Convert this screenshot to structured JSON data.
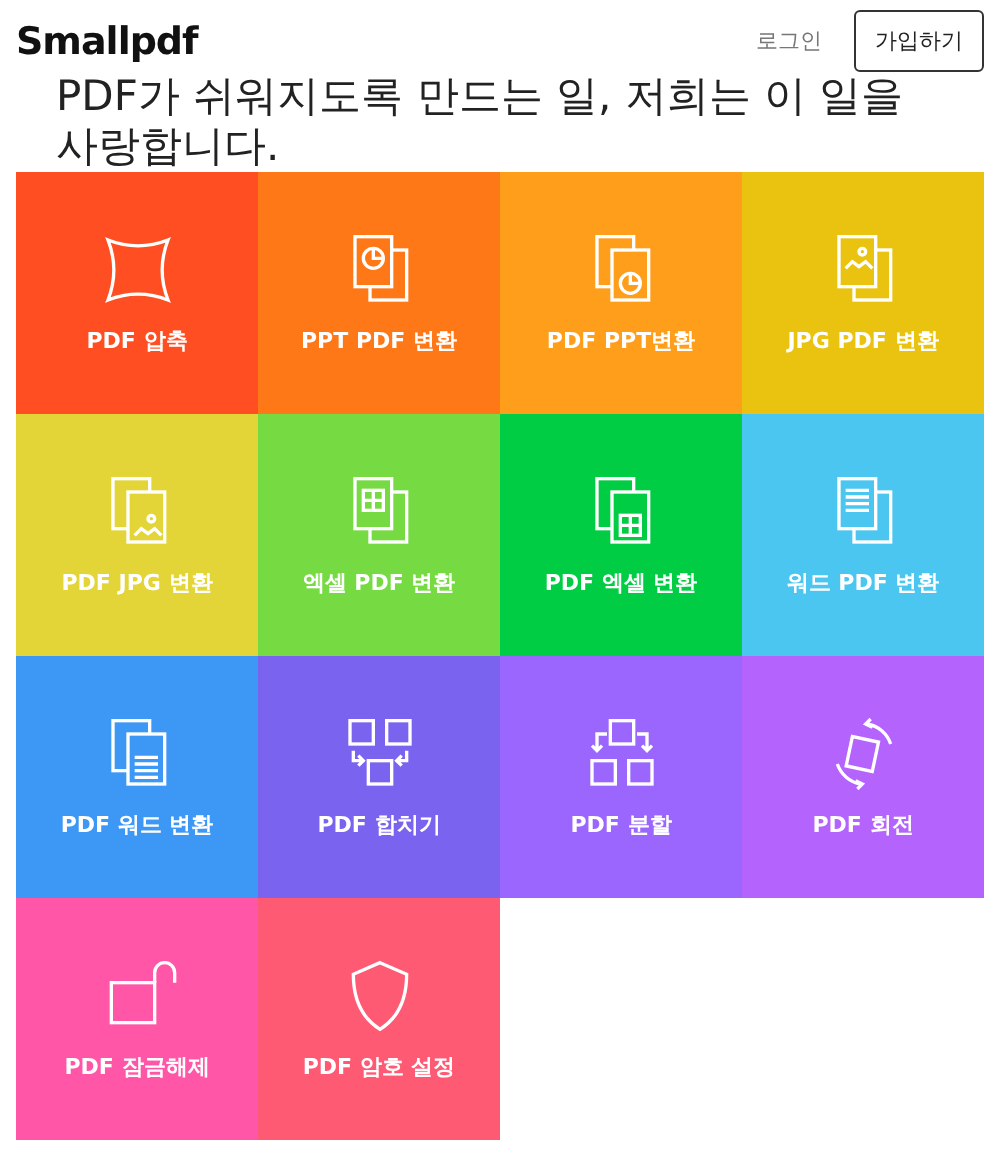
{
  "header": {
    "logo": "Smallpdf",
    "login_link": "로그인",
    "signup_button": "가입하기"
  },
  "headline": "PDF가 쉬워지도록 만드는 일, 저희는 이 일을 사랑합니다.",
  "tools": [
    {
      "label": "PDF 압축",
      "color": "#ff4e22"
    },
    {
      "label": "PPT PDF 변환",
      "color": "#ff7818"
    },
    {
      "label": "PDF PPT변환",
      "color": "#ff9e1a"
    },
    {
      "label": "JPG PDF 변환",
      "color": "#e9c310"
    },
    {
      "label": "PDF JPG 변환",
      "color": "#e3d538"
    },
    {
      "label": "엑셀 PDF 변환",
      "color": "#76da42"
    },
    {
      "label": "PDF 엑셀 변환",
      "color": "#00cc44"
    },
    {
      "label": "워드 PDF 변환",
      "color": "#4bc6f0"
    },
    {
      "label": "PDF 워드 변환",
      "color": "#3c97f5"
    },
    {
      "label": "PDF 합치기",
      "color": "#7963ef"
    },
    {
      "label": "PDF 분할",
      "color": "#9b66fd"
    },
    {
      "label": "PDF 회전",
      "color": "#b464fd"
    },
    {
      "label": "PDF 잠금해제",
      "color": "#ff56a8"
    },
    {
      "label": "PDF 암호 설정",
      "color": "#ff5a74"
    }
  ]
}
